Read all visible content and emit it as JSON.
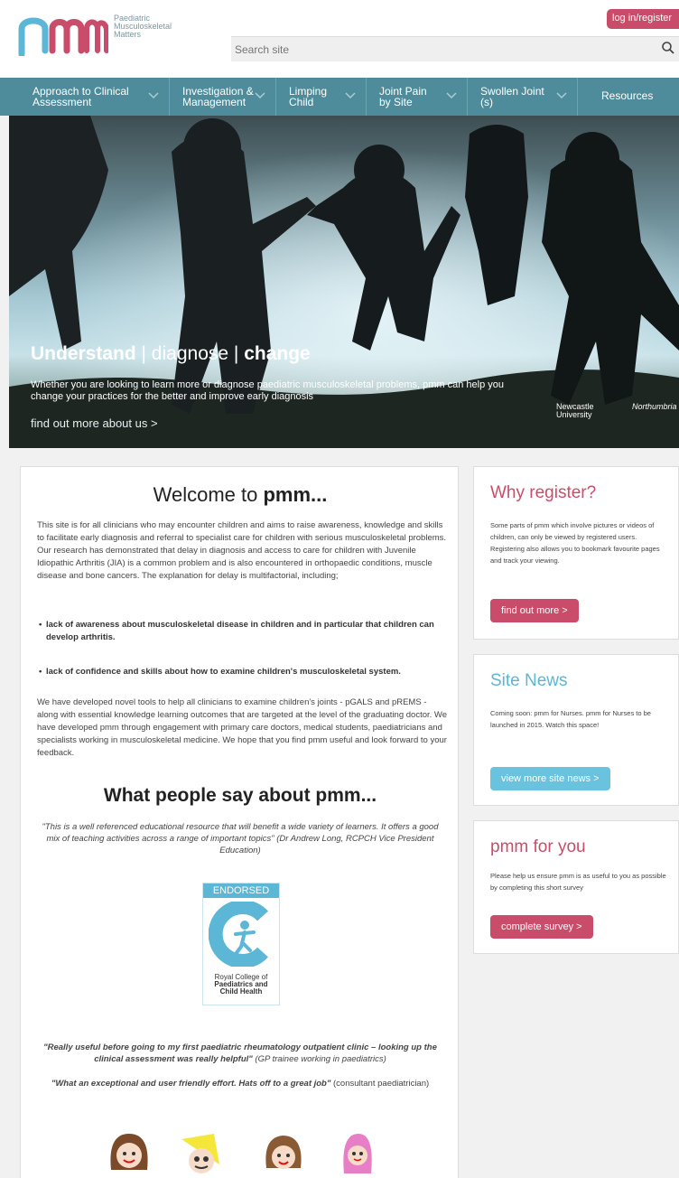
{
  "header": {
    "logo_text": "pmm",
    "logo_subtitle_lines": [
      "Paediatric",
      "Musculoskeletal",
      "Matters"
    ],
    "login_label": "log in/register",
    "search_placeholder": "Search site",
    "search_icon": "search-icon"
  },
  "nav": {
    "items": [
      {
        "label_1": "Approach to Clinical",
        "label_2": "Assessment"
      },
      {
        "label_1": "Investigation &",
        "label_2": "Management"
      },
      {
        "label_1": "Limping",
        "label_2": "Child"
      },
      {
        "label_1": "Joint Pain",
        "label_2": "by Site"
      },
      {
        "label_1": "Swollen Joint",
        "label_2": "(s)"
      },
      {
        "label_1": "Resources",
        "label_2": ""
      }
    ]
  },
  "hero": {
    "title_1": "Understand",
    "title_2": " | diagnose | ",
    "title_3": "change",
    "subtitle": "Whether you are looking to learn more or diagnose paediatric musculoskeletal problems, pmm can help you change your practices for the better and improve early diagnosis",
    "link": "find out more about us >",
    "logo_1": "Newcastle University",
    "logo_2": "Northumbria"
  },
  "main": {
    "welcome_1": "Welcome to ",
    "welcome_2": "pmm...",
    "intro": "This site is for all clinicians who may encounter children and aims to raise awareness, knowledge and skills to facilitate early diagnosis and referral to specialist care for children with serious musculoskeletal problems. Our research has demonstrated that delay in diagnosis and access to care for children with Juvenile Idiopathic Arthritis (JIA) is a common problem and is also encountered in orthopaedic conditions, muscle disease and bone cancers. The explanation for delay is multifactorial, including;",
    "bullets": [
      "lack of awareness about musculoskeletal disease in children and in particular that children can develop arthritis.",
      "lack of confidence and skills about how to examine children's musculoskeletal system."
    ],
    "developed": "We have developed novel tools to help all clinicians to examine children's joints - pGALS and pREMS - along with essential knowledge learning outcomes that are targeted at the level of the graduating doctor.  We have developed pmm through engagement with primary care doctors, medical students, paediatricians and specialists working in musculoskeletal medicine.  We hope that you find pmm useful and look forward to your feedback.",
    "what_say": "What people say about pmm...",
    "quote_1": "\"This is a well referenced educational resource that will benefit a wide variety of learners. It offers a good mix of teaching activities across a range of important topics\" (Dr Andrew Long, RCPCH Vice President Education)",
    "endorse_head": "ENDORSED",
    "endorse_line_1": "Royal College of",
    "endorse_line_2": "Paediatrics and",
    "endorse_line_3": "Child Health",
    "quote_2_bold": "\"Really useful before going to my first paediatric rheumatology outpatient clinic – looking up the clinical assessment was really helpful\"",
    "quote_2_rest": " (GP trainee working in paediatrics)",
    "quote_3_bold": "\"What an exceptional and user friendly effort. Hats off to a great job\"",
    "quote_3_rest": " (consultant paediatrician)"
  },
  "sidebar": {
    "register": {
      "title": "Why register?",
      "body": "Some parts of pmm which involve pictures or videos of children, can only be viewed by registered users. Registering also allows you to bookmark favourite pages and track your viewing.",
      "button": "find out more >",
      "title_color": "#c94d6b"
    },
    "news": {
      "title": "Site News",
      "body": "Coming soon: pmm for Nurses. pmm for Nurses to be launched in 2015. Watch this space!",
      "button": "view more site news >",
      "title_color": "#5cb6d6"
    },
    "foryou": {
      "title": "pmm for you",
      "body": "Please help us ensure pmm is as useful to you as possible by completing this short survey",
      "button": "complete survey >",
      "title_color": "#c94d6b"
    }
  },
  "colors": {
    "accent_pink": "#c94d6b",
    "accent_blue": "#69c3de",
    "nav": "#4e8c9b"
  }
}
